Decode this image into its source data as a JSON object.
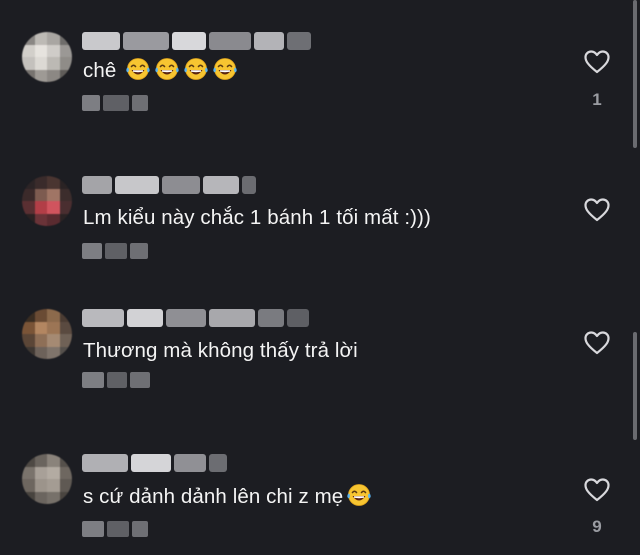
{
  "comments": [
    {
      "text": "chê",
      "emoji_icon": "laughing-tears-emoji",
      "emoji_count": 4,
      "like_count": "1",
      "avatar_colors": [
        "#8a8784",
        "#bdbab5",
        "#a9a6a2",
        "#6f6d6b",
        "#d2cfca",
        "#e6e3de",
        "#cfccc8",
        "#9b9895",
        "#c4c1bd",
        "#dcd9d4",
        "#bcb9b4",
        "#8f8c88",
        "#77736f",
        "#9e9a95",
        "#8c8884",
        "#5f5c59"
      ]
    },
    {
      "text": "Lm kiểu này chắc 1 bánh 1 tối mất :)))",
      "like_count": "",
      "avatar_colors": [
        "#2c2426",
        "#3a2b2b",
        "#4a3531",
        "#2a2324",
        "#3b2a2a",
        "#7d5b50",
        "#a07565",
        "#3c2d2c",
        "#5a2f32",
        "#b23e47",
        "#d0545e",
        "#4a2e30",
        "#2a2122",
        "#6a3338",
        "#5a2b30",
        "#2b2324"
      ]
    },
    {
      "text": "Thương mà không thấy trả lời",
      "like_count": "",
      "avatar_colors": [
        "#3a2d22",
        "#6a4b34",
        "#8c6a4c",
        "#4b3c33",
        "#7a5437",
        "#b38661",
        "#9c7555",
        "#5a4a40",
        "#5b4637",
        "#8e6f57",
        "#a58a73",
        "#6f6156",
        "#3f3833",
        "#6d625a",
        "#7f746b",
        "#55504c"
      ]
    },
    {
      "text": "s cứ dảnh dảnh lên chi z mẹ",
      "emoji_icon": "laughing-tears-emoji",
      "emoji_count": 1,
      "like_count": "9",
      "avatar_colors": [
        "#4e4944",
        "#6a645e",
        "#8a837b",
        "#55504b",
        "#7a736c",
        "#a8a098",
        "#b3aba2",
        "#6e6760",
        "#6d665f",
        "#9c948b",
        "#a49c93",
        "#5f5953",
        "#48443f",
        "#6b655f",
        "#77716a",
        "#4a4540"
      ]
    }
  ],
  "colors": {
    "background": "#1c1d22",
    "text": "#f4f4f4",
    "muted": "#9a9ca2",
    "blur_light": "#b9b9bd",
    "blur_dark": "#5a5b60"
  }
}
